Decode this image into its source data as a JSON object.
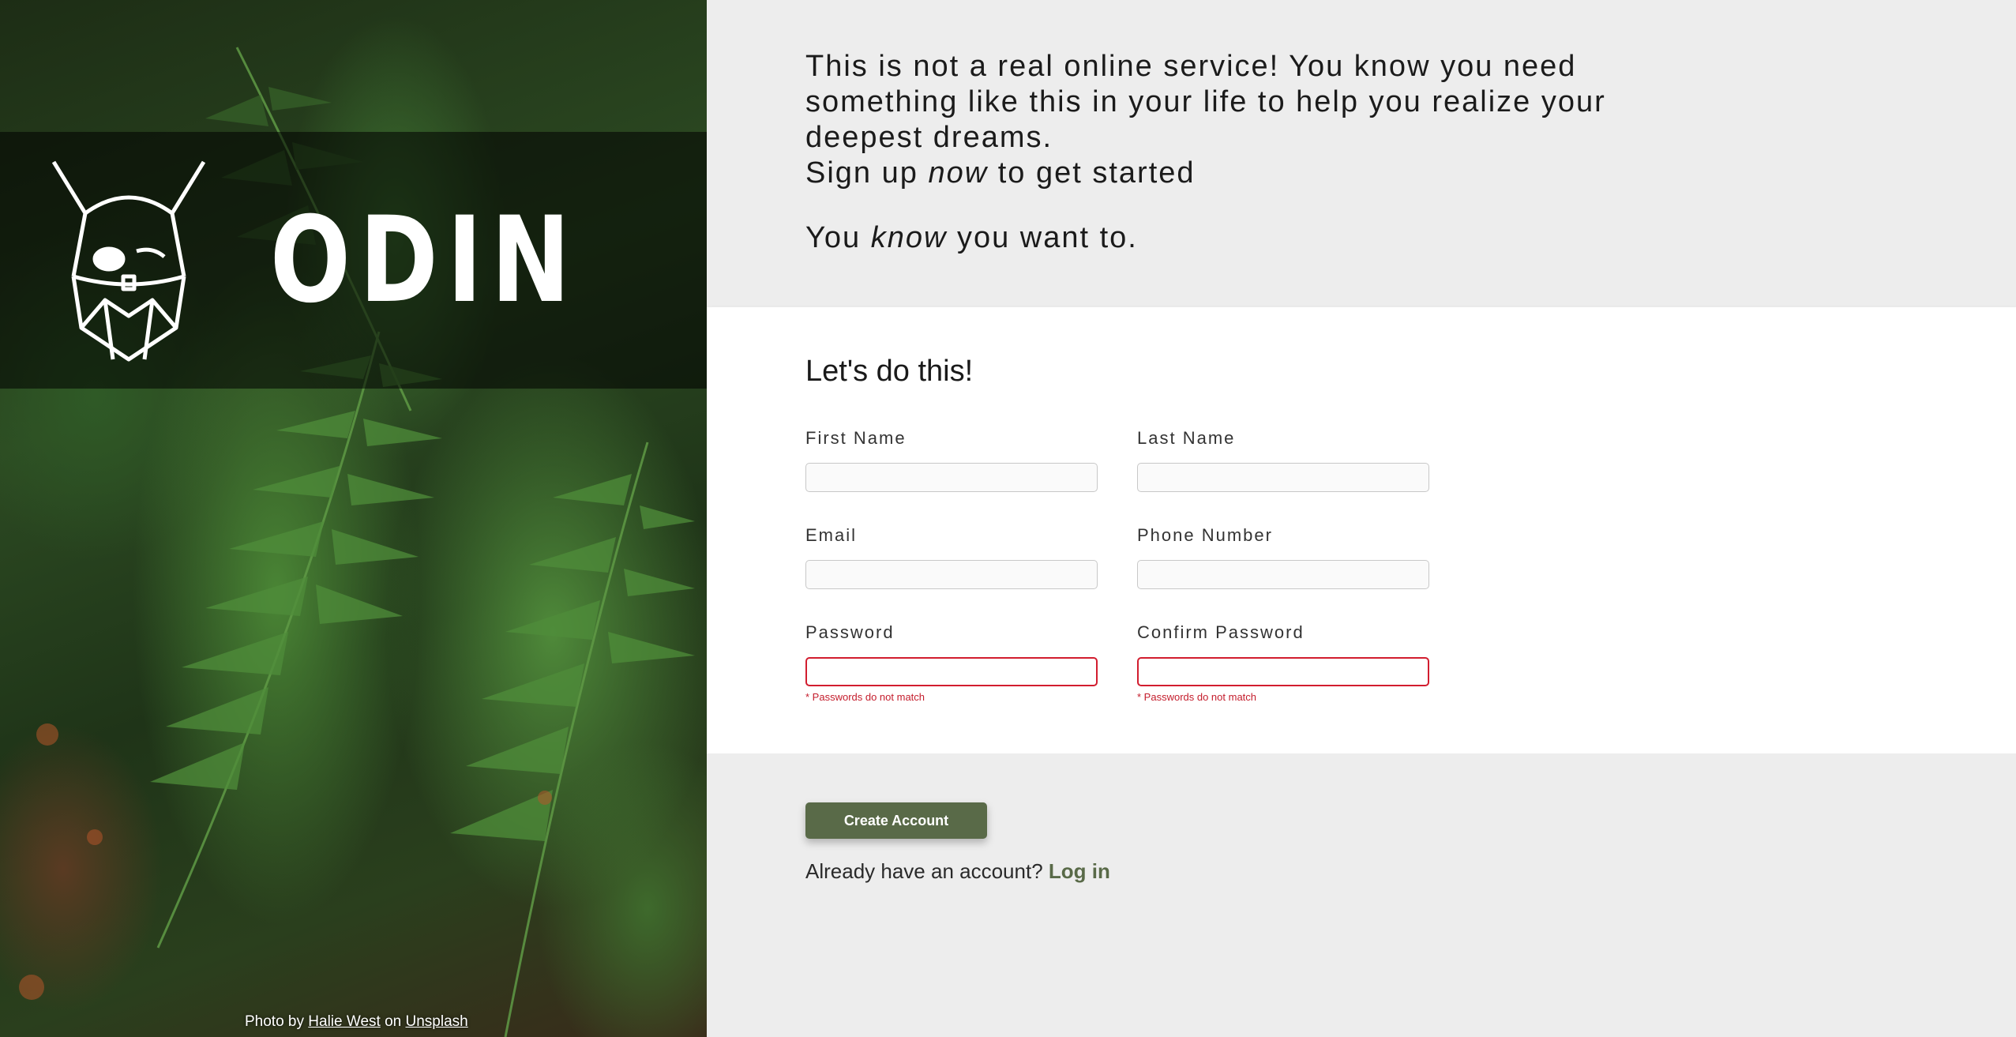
{
  "brand": {
    "wordmark": "ODIN",
    "logo_icon": "viking-head-icon"
  },
  "credit": {
    "prefix": "Photo by",
    "author": "Halie West",
    "middle": "on",
    "source": "Unsplash"
  },
  "intro": {
    "line1_a": "This is not a real online service! You know you need something like this in your life to help you realize your deepest dreams.",
    "line2_a": "Sign up ",
    "line2_em": "now",
    "line2_b": " to get started",
    "line3_a": "You ",
    "line3_em": "know",
    "line3_b": " you want to."
  },
  "form": {
    "title": "Let's do this!",
    "fields": [
      {
        "label": "First Name",
        "value": "",
        "error": ""
      },
      {
        "label": "Last Name",
        "value": "",
        "error": ""
      },
      {
        "label": "Email",
        "value": "",
        "error": ""
      },
      {
        "label": "Phone Number",
        "value": "",
        "error": ""
      },
      {
        "label": "Password",
        "value": "",
        "error": "* Passwords do not match"
      },
      {
        "label": "Confirm Password",
        "value": "",
        "error": "* Passwords do not match"
      }
    ]
  },
  "actions": {
    "create_label": "Create Account",
    "login_prompt": "Already have an account?",
    "login_link": "Log in"
  },
  "colors": {
    "accent": "#596a48",
    "error": "#d21d2f",
    "panel_bg": "#ededed",
    "form_bg": "#ffffff"
  }
}
